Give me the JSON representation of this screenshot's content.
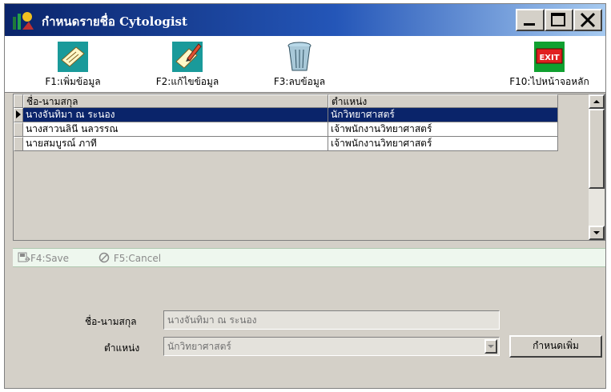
{
  "window": {
    "title": "กำหนดรายชื่อ Cytologist"
  },
  "toolbar": {
    "add_label": "F1:เพิ่มข้อมูล",
    "edit_label": "F2:แก้ไขข้อมูล",
    "delete_label": "F3:ลบข้อมูล",
    "exit_label": "F10:ไปหน้าจอหลัก",
    "exit_icon_text": "EXIT"
  },
  "grid": {
    "columns": [
      "ชื่อ-นามสกุล",
      "ตำแหน่ง"
    ],
    "rows": [
      {
        "name": "นางจันทิมา ณ ระนอง",
        "position": "นักวิทยาศาสตร์",
        "selected": true
      },
      {
        "name": "นางสาวนลินี นลวรรณ",
        "position": "เจ้าพนักงานวิทยาศาสตร์",
        "selected": false
      },
      {
        "name": "นายสมบูรณ์ ภาที",
        "position": "เจ้าพนักงานวิทยาศาสตร์",
        "selected": false
      }
    ]
  },
  "actions": {
    "save_label": "F4:Save",
    "cancel_label": "F5:Cancel"
  },
  "form": {
    "name_label": "ชื่อ-นามสกุล",
    "name_value": "นางจันทิมา ณ ระนอง",
    "position_label": "ตำแหน่ง",
    "position_value": "นักวิทยาศาสตร์",
    "add_position_label": "กำหนดเพิ่ม"
  },
  "colors": {
    "selection": "#0a246a",
    "face": "#d4d0c8",
    "actionbar": "#eef7ee"
  }
}
